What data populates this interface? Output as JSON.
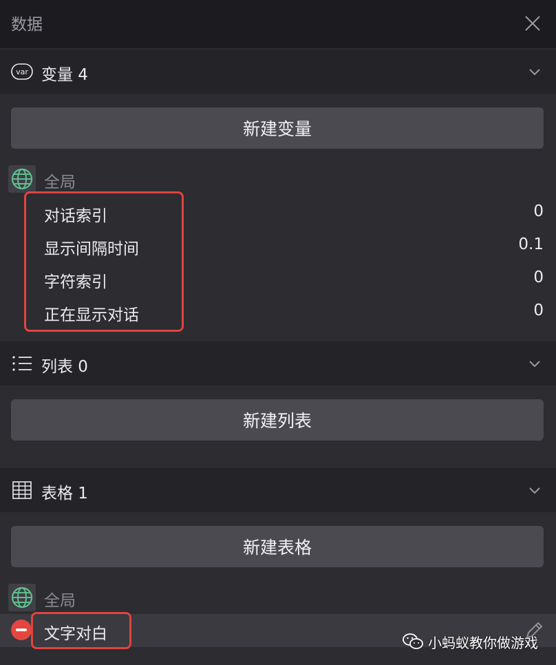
{
  "panel": {
    "title": "数据"
  },
  "variables": {
    "header": "变量 4",
    "icon": "var-icon",
    "new_button": "新建变量",
    "scope_label": "全局",
    "items": [
      {
        "name": "对话索引",
        "value": "0"
      },
      {
        "name": "显示间隔时间",
        "value": "0.1"
      },
      {
        "name": "字符索引",
        "value": "0"
      },
      {
        "name": "正在显示对话",
        "value": "0"
      }
    ]
  },
  "lists": {
    "header": "列表 0",
    "icon": "list-icon",
    "new_button": "新建列表"
  },
  "tables": {
    "header": "表格 1",
    "icon": "table-grid-icon",
    "new_button": "新建表格",
    "scope_label": "全局",
    "items": [
      {
        "name": "文字对白"
      }
    ]
  },
  "watermark": {
    "text": "小蚂蚁教你做游戏"
  },
  "colors": {
    "highlight": "#e0443e",
    "remove": "#e5463f",
    "globe": "#5fbf8f"
  }
}
